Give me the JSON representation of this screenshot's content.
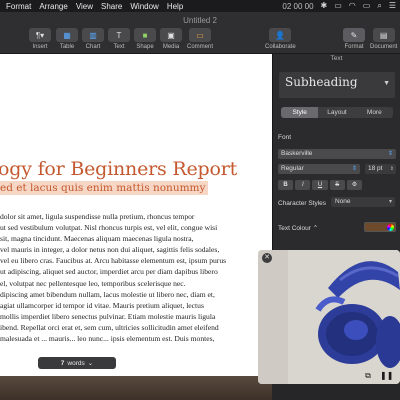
{
  "menubar": {
    "items": [
      "Format",
      "Arrange",
      "View",
      "Share",
      "Window",
      "Help"
    ],
    "clock": "02 00 00"
  },
  "window": {
    "title": "Untitled 2"
  },
  "toolbar": {
    "insert_label": "Insert",
    "table_label": "Table",
    "chart_label": "Chart",
    "text_label": "Text",
    "shape_label": "Shape",
    "media_label": "Media",
    "comment_label": "Comment",
    "collaborate_label": "Collaborate",
    "format_label": "Format",
    "document_label": "Document"
  },
  "document": {
    "title": "ogy for Beginners Report",
    "subtitle": "ed et lacus quis enim mattis nonummy",
    "body_lines": [
      "dolor sit amet, ligula suspendisse nulla pretium, rhoncus tempor",
      "ut sed vestibulum volutpat. Nisl rhoncus turpis est, vel elit, congue wisi",
      "sit, magna tincidunt. Maecenas aliquam maecenas ligula nostra,",
      "vel mauris in integer, a dolor netus non dui aliquet, sagittis felis sodales,",
      "vel eu libero cras. Faucibus at. Arcu habitasse elementum est, ipsum purus",
      "ut adipiscing, aliquet sed auctor, imperdiet arcu per diam dapibus libero",
      "el, volutpat nec pellentesque leo, temporibus scelerisque nec.",
      "dipiscing amet bibendum nullam, lacus molestie ut libero nec, diam et,",
      "agiat ullamcorper id tempor id vitae. Mauris pretium aliquet, lectus",
      "mollis imperdiet libero senectus pulvinar. Etiam molestie mauris ligula",
      "ibend. Repellat orci erat et, sem cum, ultricies sollicitudin amet eleifend",
      "malesuada et ... mauris... leo nunc... ipsis elementum est. Duis montes,"
    ]
  },
  "status": {
    "word_count": "7",
    "word_label": "words"
  },
  "panel": {
    "header": "Text",
    "paragraph_style": "Subheading",
    "tabs": [
      "Style",
      "Layout",
      "More"
    ],
    "active_tab": "Style",
    "font_section": "Font",
    "font_family": "Baskerville",
    "font_style": "Regular",
    "font_size": "18 pt",
    "format_buttons": [
      "B",
      "I",
      "U",
      "S",
      "⚙"
    ],
    "character_styles_label": "Character Styles",
    "character_styles_value": "None",
    "text_colour_label": "Text Colour",
    "text_colour": "#6d4a2c"
  },
  "colors": {
    "accent": "#c4582f",
    "highlight": "#f6d6c4",
    "headphones": "#2f3f9a"
  }
}
